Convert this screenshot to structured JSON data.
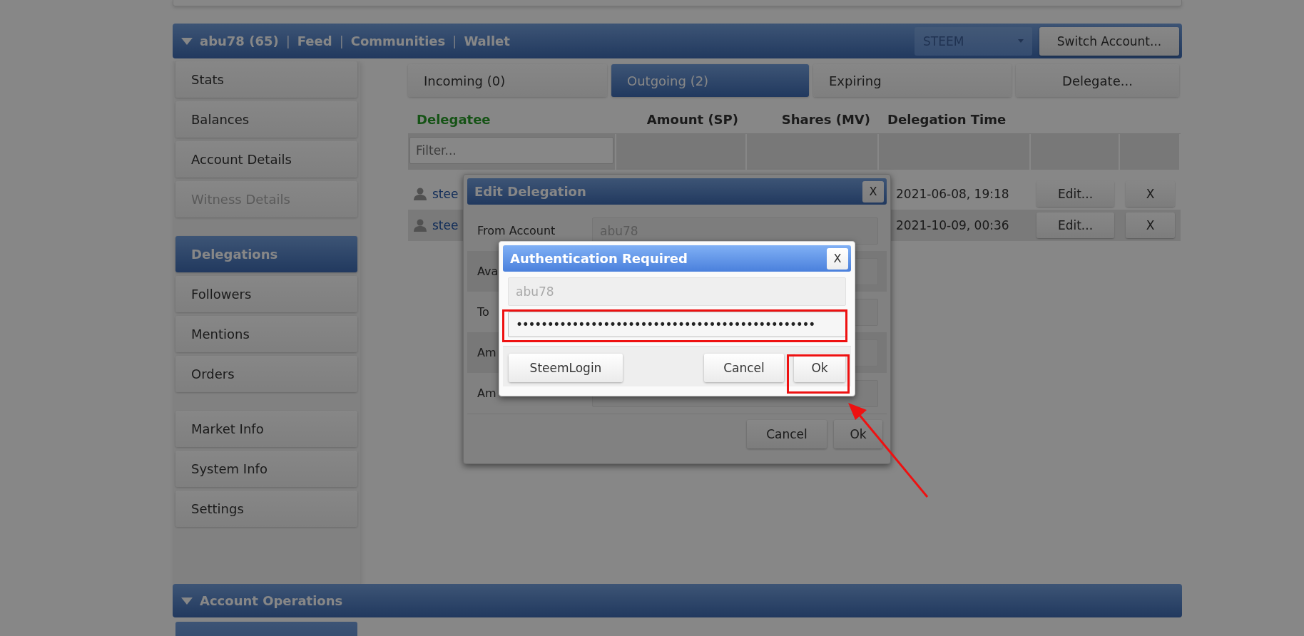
{
  "header": {
    "nav": [
      {
        "kind": "link",
        "text": "abu78 (65)"
      },
      {
        "kind": "separator",
        "text": "|"
      },
      {
        "kind": "link",
        "text": "Feed"
      },
      {
        "kind": "separator",
        "text": "|"
      },
      {
        "kind": "link",
        "text": "Communities"
      },
      {
        "kind": "separator",
        "text": "|"
      },
      {
        "kind": "link",
        "text": "Wallet"
      }
    ],
    "currency_select": {
      "value": "STEEM"
    },
    "switch_button": "Switch Account..."
  },
  "sidebar": {
    "groups": [
      [
        {
          "label": "Stats",
          "selected": false,
          "disabled": false
        },
        {
          "label": "Balances",
          "selected": false,
          "disabled": false
        },
        {
          "label": "Account Details",
          "selected": false,
          "disabled": false
        },
        {
          "label": "Witness Details",
          "selected": false,
          "disabled": true
        }
      ],
      [
        {
          "label": "Delegations",
          "selected": true,
          "disabled": false
        },
        {
          "label": "Followers",
          "selected": false,
          "disabled": false
        },
        {
          "label": "Mentions",
          "selected": false,
          "disabled": false
        },
        {
          "label": "Orders",
          "selected": false,
          "disabled": false
        }
      ],
      [
        {
          "label": "Market Info",
          "selected": false,
          "disabled": false
        },
        {
          "label": "System Info",
          "selected": false,
          "disabled": false
        },
        {
          "label": "Settings",
          "selected": false,
          "disabled": false
        }
      ]
    ]
  },
  "tabs": [
    {
      "kind": "tab",
      "label": "Incoming (0)",
      "selected": false
    },
    {
      "kind": "tab",
      "label": "Outgoing (2)",
      "selected": true
    },
    {
      "kind": "tab",
      "label": "Expiring",
      "selected": false
    },
    {
      "kind": "button",
      "label": "Delegate...",
      "selected": false
    }
  ],
  "table": {
    "columns": [
      {
        "label": "Delegatee",
        "highlighted": true
      },
      {
        "label": "Amount (SP)",
        "highlighted": false
      },
      {
        "label": "Shares (MV)",
        "highlighted": false
      },
      {
        "label": "Delegation Time",
        "highlighted": false
      }
    ],
    "filter": {
      "placeholder": "Filter..."
    },
    "rows": [
      {
        "delegatee": "stee",
        "time": "2021-06-08, 19:18",
        "edit": "Edit...",
        "remove": "X"
      },
      {
        "delegatee": "stee",
        "time": "2021-10-09, 00:36",
        "edit": "Edit...",
        "remove": "X"
      }
    ]
  },
  "edit_dialog": {
    "title": "Edit Delegation",
    "close": "X",
    "fields": [
      {
        "label": "From Account",
        "value": "abu78"
      },
      {
        "label": "Ava"
      },
      {
        "label": "To"
      },
      {
        "label": "Am"
      },
      {
        "label": "Am"
      }
    ],
    "buttons": [
      "Cancel",
      "Ok"
    ]
  },
  "auth_dialog": {
    "title": "Authentication Required",
    "close": "X",
    "username": "abu78",
    "password": "••••••••••••••••••••••••••••••••••••••••••••••••",
    "left_button": "SteemLogin",
    "buttons": [
      "Cancel",
      "Ok"
    ]
  },
  "operations": {
    "title": "Account Operations"
  }
}
